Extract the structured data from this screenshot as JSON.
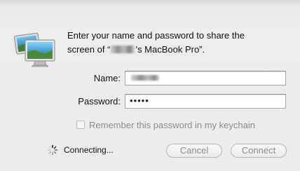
{
  "dialog": {
    "message_line1": "Enter your name and password to share the",
    "message_line2_prefix": "screen of “",
    "message_line2_suffix": "’s MacBook Pro”."
  },
  "form": {
    "name_label": "Name:",
    "password_label": "Password:",
    "password_mask": "•••••",
    "remember_label": "Remember this password in my keychain",
    "remember_checked": false
  },
  "footer": {
    "status_text": "Connecting...",
    "cancel_label": "Cancel",
    "connect_label": "Connect"
  },
  "icons": {
    "app": "screen-sharing-icon",
    "spinner": "loading-spinner-icon"
  }
}
